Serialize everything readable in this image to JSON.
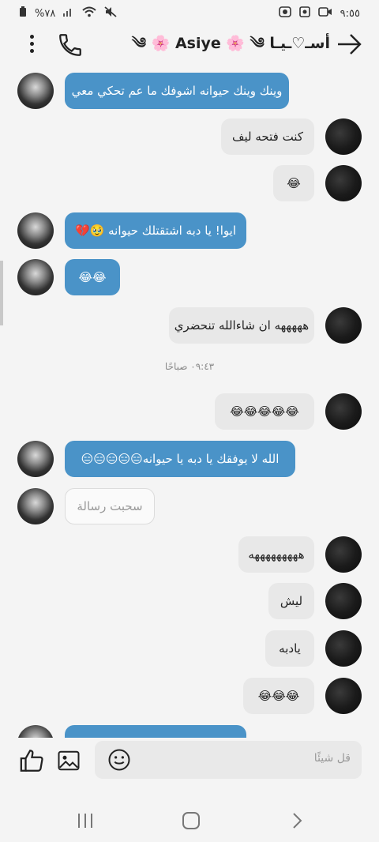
{
  "status_bar": {
    "time": "٩:٥٥",
    "battery": "%٧٨"
  },
  "header": {
    "title": "أسـ♡ـيـا ༄ 🌸 Asiye 🌸 ༄"
  },
  "messages": [
    {
      "sender": "them",
      "text": "وينك وينك حيوانه اشوفك ما عم تحكي معي"
    },
    {
      "sender": "me",
      "text": "كنت فتحه ليف"
    },
    {
      "sender": "me",
      "text": "😂"
    },
    {
      "sender": "them",
      "text": "ايوا! يا دبه اشتقتلك حيوانه 🥹💔"
    },
    {
      "sender": "them",
      "text": "😂😂"
    },
    {
      "sender": "me",
      "text": "هههههه ان شاءالله  تنحضري"
    },
    {
      "sender": "me",
      "text": "😂😂😂😂😂"
    },
    {
      "sender": "them",
      "text": "الله لا يوفقك يا دبه يا حيوانه😑😑😑😑😑"
    },
    {
      "sender": "them",
      "text": "سحبت رسالة"
    },
    {
      "sender": "me",
      "text": "هههههههههه"
    },
    {
      "sender": "me",
      "text": "ليش"
    },
    {
      "sender": "me",
      "text": "يادبه"
    },
    {
      "sender": "me",
      "text": "😂😂😂"
    }
  ],
  "timestamp": "٠٩:٤٣ صباحًا",
  "composer": {
    "placeholder": "قل شيئًا"
  }
}
